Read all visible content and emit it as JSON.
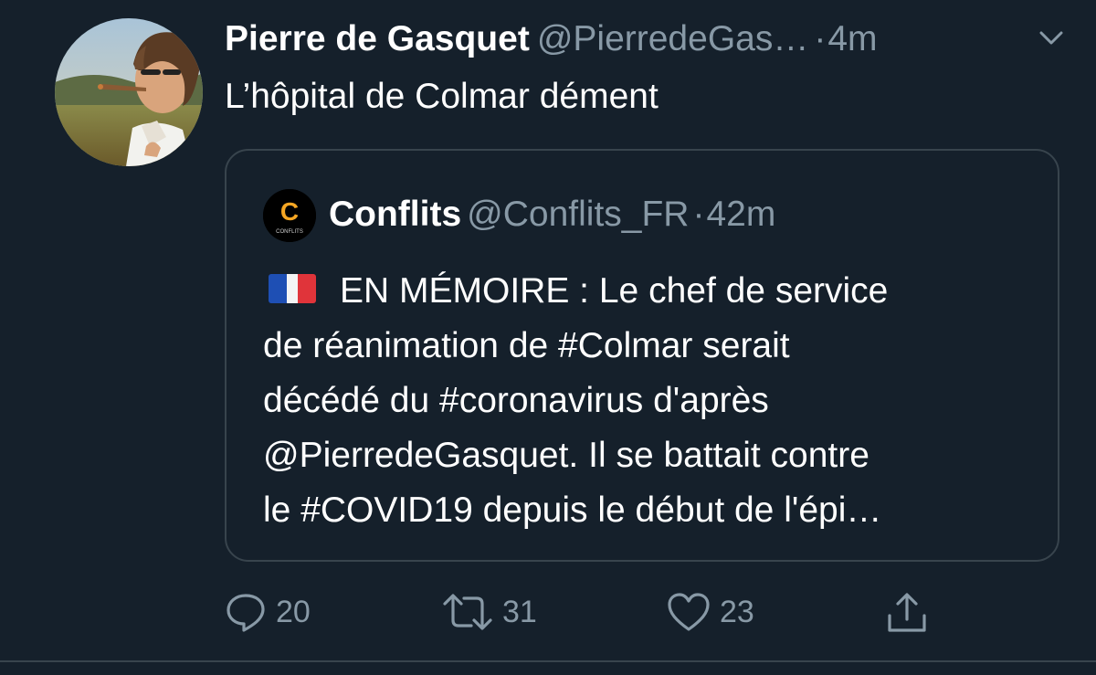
{
  "tweet": {
    "display_name": "Pierre de Gasquet",
    "handle": "@PierredeGas…",
    "separator": "·",
    "time": "4m",
    "text": "L’hôpital de Colmar dément"
  },
  "quoted_tweet": {
    "display_name": "Conflits",
    "handle": "@Conflits_FR",
    "separator": "·",
    "time": "42m",
    "avatar_letter": "C",
    "avatar_caption": "CONFLITS",
    "lines": [
      "EN MÉMOIRE : Le chef de service",
      "de réanimation de #Colmar serait",
      "décédé du #coronavirus d'après",
      "@PierredeGasquet. Il se battait contre",
      "le #COVID19 depuis le début de l'épi…"
    ]
  },
  "actions": {
    "replies": "20",
    "retweets": "31",
    "likes": "23"
  },
  "colors": {
    "background": "#15202b",
    "secondary_text": "#8899a6",
    "border": "#38444d",
    "brand_orange": "#f5a623"
  },
  "icons": {
    "reply": "reply-icon",
    "retweet": "retweet-icon",
    "like": "heart-icon",
    "share": "share-icon",
    "menu": "chevron-down-icon",
    "flag": "france-flag-icon"
  }
}
